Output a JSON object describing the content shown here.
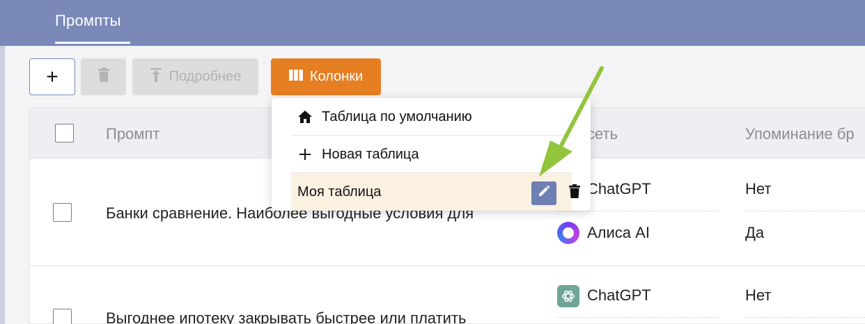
{
  "header": {
    "tab_label": "Промпты"
  },
  "toolbar": {
    "add_label": "+",
    "details_label": "Подробнее",
    "columns_label": "Колонки",
    "accent_color": "#e67e22"
  },
  "table": {
    "columns": [
      "Промпт",
      "Нейросеть",
      "Упоминание бр"
    ],
    "rows": [
      {
        "prompt": "Банки сравнение. Наиболее выгодные условия для",
        "entries": [
          {
            "network": "ChatGPT",
            "icon": "chatgpt-icon",
            "mention": "Нет"
          },
          {
            "network": "Алиса AI",
            "icon": "alice-icon",
            "mention": "Да"
          }
        ]
      },
      {
        "prompt": "Выгоднее ипотеку закрывать быстрее или платить",
        "entries": [
          {
            "network": "ChatGPT",
            "icon": "chatgpt-icon",
            "mention": "Нет"
          }
        ]
      }
    ]
  },
  "columns_menu": {
    "items": [
      {
        "label": "Таблица по умолчанию",
        "icon": "home-icon"
      },
      {
        "label": "Новая таблица",
        "icon": "plus-icon"
      }
    ],
    "saved_table": {
      "label": "Моя таблица",
      "edit_icon": "pencil-icon",
      "delete_icon": "trash-icon"
    }
  }
}
